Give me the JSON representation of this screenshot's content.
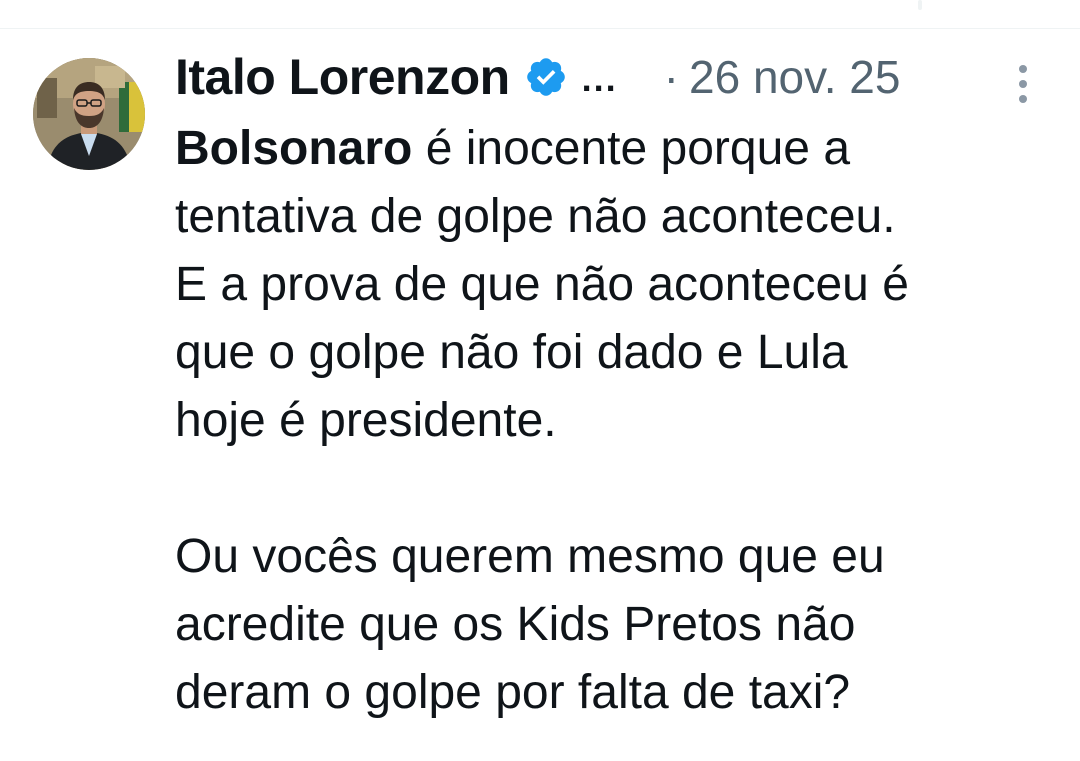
{
  "author": {
    "name": "Italo Lorenzon",
    "ellipsis": "...",
    "verified_color": "#1d9bf0"
  },
  "meta": {
    "separator": "·",
    "timestamp": "26 nov. 25"
  },
  "tweet": {
    "paragraph1_bold": "Bolsonaro",
    "paragraph1_lines": [
      " é inocente porque a",
      "tentativa de golpe não aconteceu.",
      "E a prova de que não aconteceu é",
      "que o golpe não foi dado e Lula",
      "hoje é presidente."
    ],
    "paragraph2_lines": [
      "Ou vocês querem mesmo que eu",
      "acredite que os Kids Pretos não",
      "deram o golpe por falta de taxi?"
    ]
  },
  "icons": {
    "verified": "verified-badge-icon",
    "more": "more-vertical-icon"
  }
}
